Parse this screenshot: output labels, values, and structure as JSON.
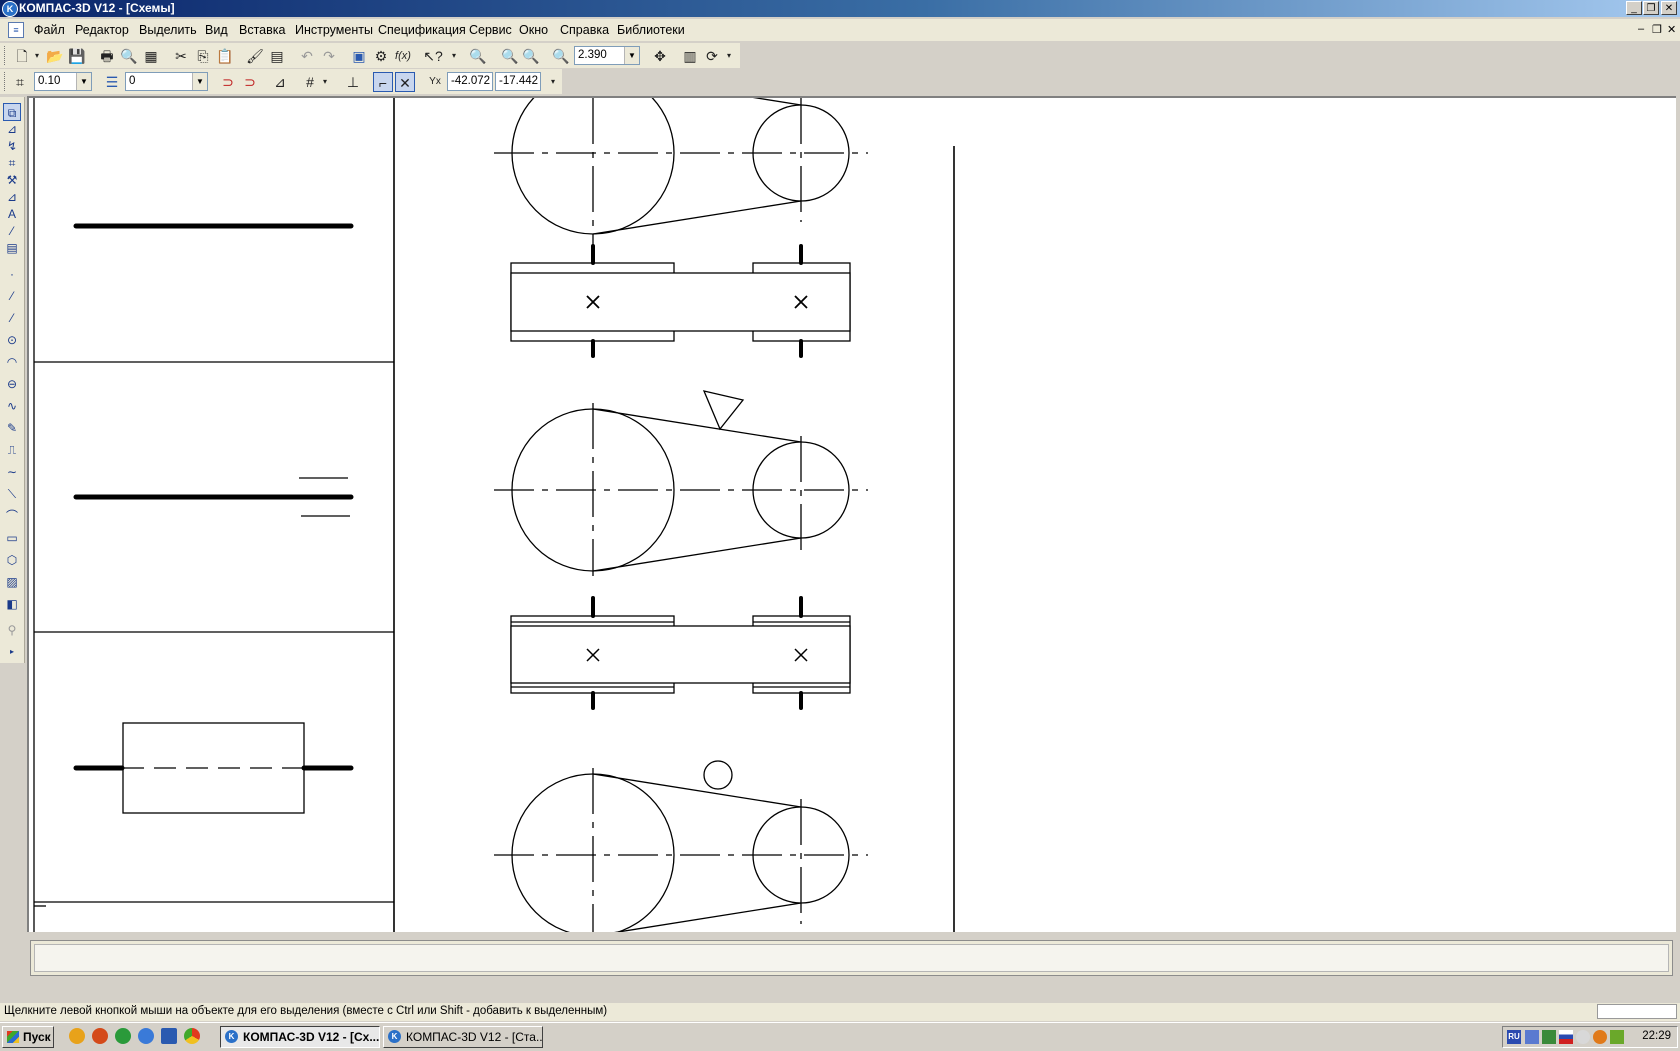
{
  "window": {
    "title": "КОМПАС-3D V12 - [Схемы]"
  },
  "menu": [
    "Файл",
    "Редактор",
    "Выделить",
    "Вид",
    "Вставка",
    "Инструменты",
    "Спецификация",
    "Сервис",
    "Окно",
    "Справка",
    "Библиотеки"
  ],
  "toolbar": {
    "zoom": "2.390",
    "step": "0.10",
    "layer": "0",
    "coord_x": "-42.072",
    "coord_y": "-17.442"
  },
  "status": {
    "hint": "Щелкните левой кнопкой мыши на объекте для его выделения (вместе с Ctrl или Shift - добавить к выделенным)"
  },
  "taskbar": {
    "start": "Пуск",
    "tasks": [
      "КОМПАС-3D V12 - [Сх...",
      "КОМПАС-3D V12 - [Ста..."
    ],
    "clock": "22:29",
    "lang": "RU"
  },
  "icons": {
    "new": "new-document-icon",
    "open": "open-folder-icon",
    "save": "save-icon",
    "print": "print-icon",
    "cut": "cut-icon",
    "copy": "copy-icon",
    "paste": "paste-icon",
    "undo": "undo-icon",
    "redo": "redo-icon",
    "help": "help-pointer-icon",
    "zoom_in": "zoom-in-icon",
    "pan": "pan-icon",
    "refresh": "refresh-icon"
  },
  "colors": {
    "titlebar": "#0a246a",
    "face": "#ece9d8",
    "canvas": "#ffffff"
  }
}
